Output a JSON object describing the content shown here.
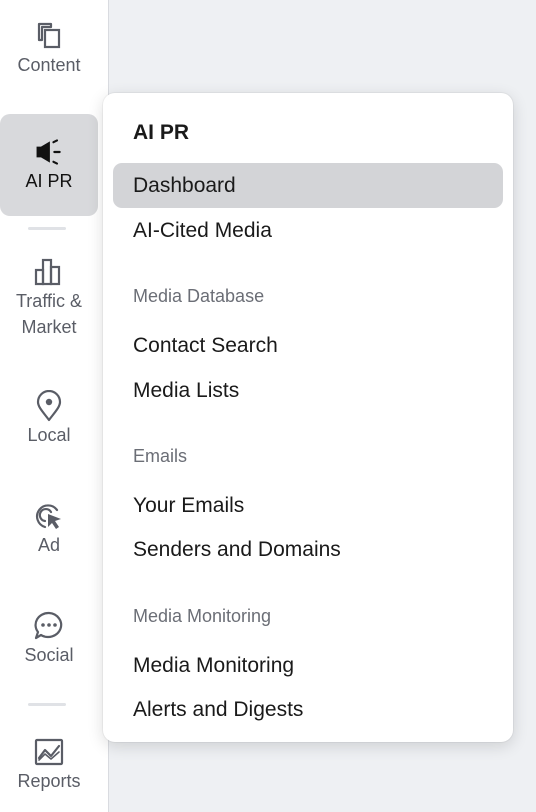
{
  "rail": {
    "items": [
      {
        "label": "Content",
        "icon": "content-pages-icon"
      },
      {
        "label": "AI PR",
        "icon": "megaphone-icon"
      },
      {
        "label": "Traffic &\nMarket",
        "icon": "bar-chart-icon"
      },
      {
        "label": "Local",
        "icon": "location-pin-icon"
      },
      {
        "label": "Ad",
        "icon": "cursor-click-icon"
      },
      {
        "label": "Social",
        "icon": "chat-bubble-icon"
      },
      {
        "label": "Reports",
        "icon": "report-chart-icon"
      }
    ],
    "active": "AI PR"
  },
  "flyout": {
    "title": "AI PR",
    "items": {
      "dashboard": "Dashboard",
      "ai_cited_media": "AI-Cited Media",
      "contact_search": "Contact Search",
      "media_lists": "Media Lists",
      "your_emails": "Your Emails",
      "senders_domains": "Senders and Domains",
      "media_monitoring": "Media Monitoring",
      "alerts_digests": "Alerts and Digests"
    },
    "sections": {
      "media_database": "Media Database",
      "emails": "Emails",
      "media_monitoring": "Media Monitoring"
    },
    "selected": "Dashboard"
  }
}
